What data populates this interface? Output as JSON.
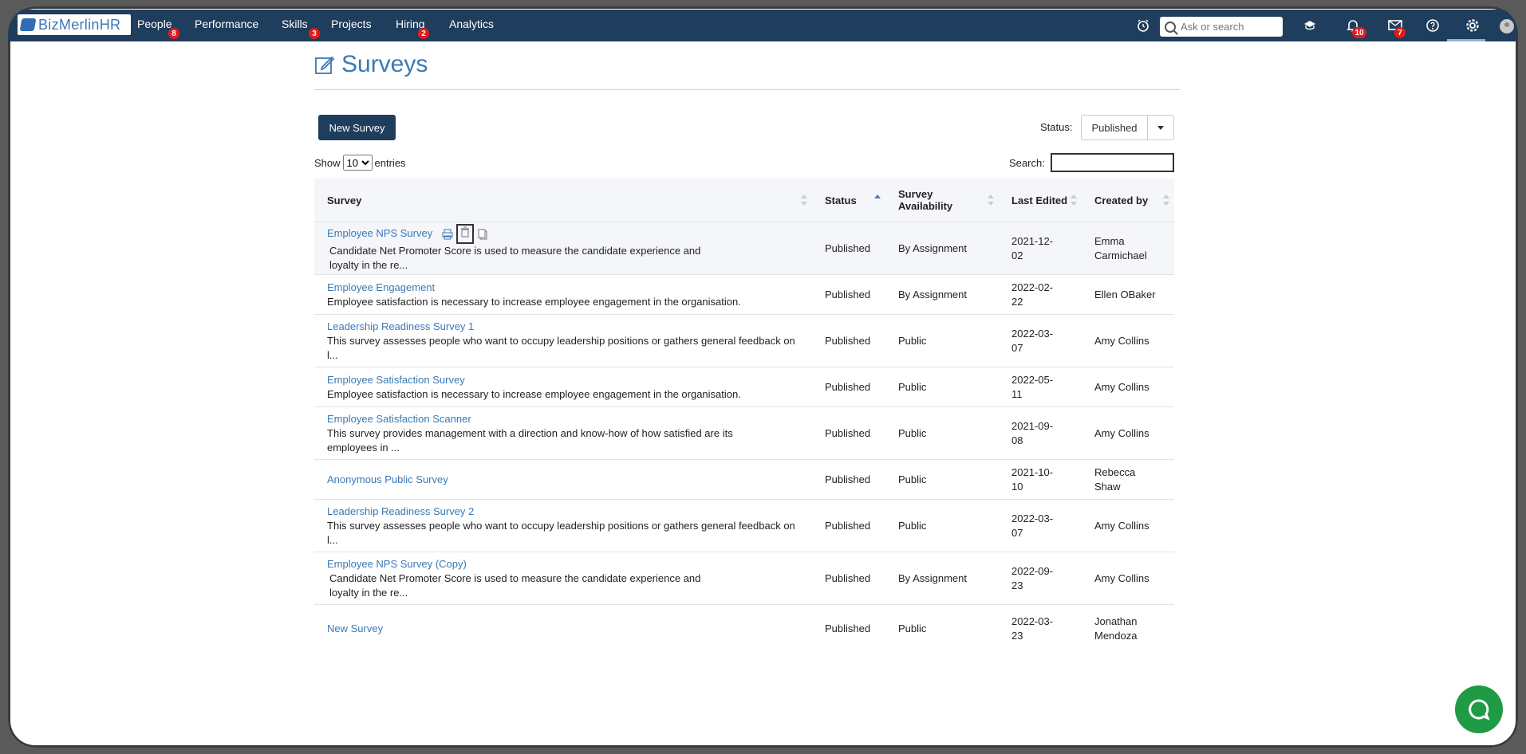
{
  "app": {
    "logo_text": "BizMerlinHR"
  },
  "nav": {
    "items": [
      {
        "label": "People",
        "badge": "8"
      },
      {
        "label": "Performance",
        "badge": ""
      },
      {
        "label": "Skills",
        "badge": "3"
      },
      {
        "label": "Projects",
        "badge": ""
      },
      {
        "label": "Hiring",
        "badge": "2"
      },
      {
        "label": "Analytics",
        "badge": ""
      }
    ],
    "search_placeholder": "Ask or search",
    "notifications_badge": "10",
    "messages_badge": "7"
  },
  "page": {
    "title": "Surveys",
    "new_button": "New Survey",
    "status_label": "Status:",
    "status_value": "Published",
    "show_label": "Show",
    "entries_value": "10",
    "entries_label": "entries",
    "search_label": "Search:"
  },
  "table": {
    "headers": [
      "Survey",
      "Status",
      "Survey Availability",
      "Last Edited",
      "Created by"
    ],
    "rows": [
      {
        "title": "Employee NPS Survey",
        "desc": "Candidate Net Promoter Score is used to measure the candidate experience and loyalty in the re...",
        "status": "Published",
        "availability": "By Assignment",
        "edited": "2021-12-02",
        "created_by": "Emma Carmichael"
      },
      {
        "title": "Employee Engagement",
        "desc": "Employee  satisfaction is necessary to increase employee engagement in the  organisation.",
        "status": "Published",
        "availability": "By Assignment",
        "edited": "2022-02-22",
        "created_by": "Ellen OBaker"
      },
      {
        "title": "Leadership Readiness Survey 1",
        "desc": "This survey assesses people who want to occupy leadership positions or gathers general feedback on l...",
        "status": "Published",
        "availability": "Public",
        "edited": "2022-03-07",
        "created_by": "Amy Collins"
      },
      {
        "title": "Employee Satisfaction Survey",
        "desc": "Employee  satisfaction is necessary to increase employee engagement in the  organisation.",
        "status": "Published",
        "availability": "Public",
        "edited": "2022-05-11",
        "created_by": "Amy Collins"
      },
      {
        "title": "Employee Satisfaction Scanner",
        "desc": "This survey provides management with a direction and know-how of how satisfied are its employees in ...",
        "status": "Published",
        "availability": "Public",
        "edited": "2021-09-08",
        "created_by": "Amy Collins"
      },
      {
        "title": "Anonymous Public Survey",
        "desc": "",
        "status": "Published",
        "availability": "Public",
        "edited": "2021-10-10",
        "created_by": "Rebecca Shaw"
      },
      {
        "title": "Leadership Readiness Survey 2",
        "desc": "This survey assesses people who want to occupy leadership positions or gathers general feedback on l...",
        "status": "Published",
        "availability": "Public",
        "edited": "2022-03-07",
        "created_by": "Amy Collins"
      },
      {
        "title": "Employee NPS Survey (Copy)",
        "desc": "Candidate Net Promoter Score is used to measure the candidate experience and loyalty in the re...",
        "status": "Published",
        "availability": "By Assignment",
        "edited": "2022-09-23",
        "created_by": "Amy Collins"
      },
      {
        "title": "New Survey",
        "desc": "",
        "status": "Published",
        "availability": "Public",
        "edited": "2022-03-23",
        "created_by": "Jonathan Mendoza"
      }
    ]
  },
  "colors": {
    "nav_bg": "#1f3d5c",
    "link": "#3a79b6",
    "badge": "#e31b1b",
    "chat": "#1f9a45"
  }
}
